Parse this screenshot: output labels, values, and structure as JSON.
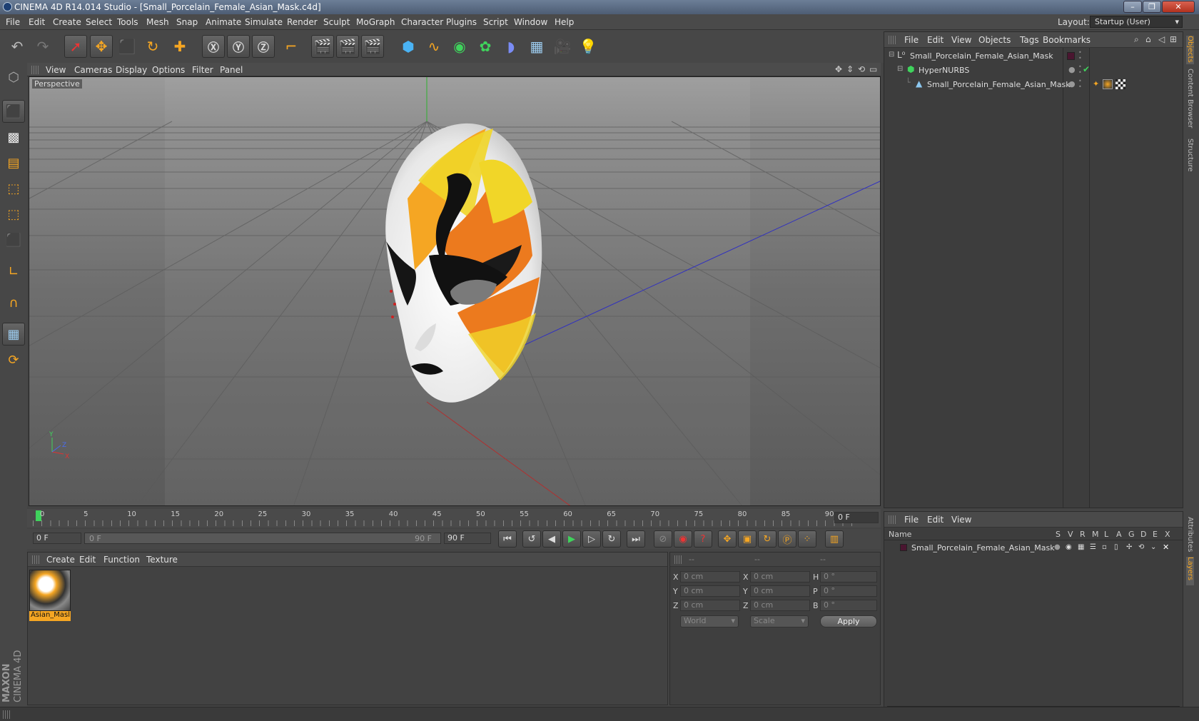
{
  "window": {
    "title": "CINEMA 4D R14.014 Studio - [Small_Porcelain_Female_Asian_Mask.c4d]"
  },
  "menu": [
    "File",
    "Edit",
    "Create",
    "Select",
    "Tools",
    "Mesh",
    "Snap",
    "Animate",
    "Simulate",
    "Render",
    "Sculpt",
    "MoGraph",
    "Character",
    "Plugins",
    "Script",
    "Window",
    "Help"
  ],
  "layout": {
    "label": "Layout:",
    "value": "Startup (User)"
  },
  "viewport": {
    "menu": [
      "View",
      "Cameras",
      "Display",
      "Options",
      "Filter",
      "Panel"
    ],
    "label": "Perspective",
    "axis": {
      "x": "X",
      "y": "Y",
      "z": "Z"
    }
  },
  "timeline": {
    "ticks": [
      "0",
      "5",
      "10",
      "15",
      "20",
      "25",
      "30",
      "35",
      "40",
      "45",
      "50",
      "55",
      "60",
      "65",
      "70",
      "75",
      "80",
      "85",
      "90"
    ],
    "current_frame": "0 F",
    "start_field": "0 F",
    "range_start": "0 F",
    "range_end": "90 F",
    "end_field": "90 F"
  },
  "material": {
    "menu": [
      "Create",
      "Edit",
      "Function",
      "Texture"
    ],
    "items": [
      {
        "name": "Asian_Masl"
      }
    ]
  },
  "coords": {
    "headers": [
      "--",
      "--",
      "--"
    ],
    "rows": [
      {
        "a": "X",
        "v1": "0 cm",
        "b": "X",
        "v2": "0 cm",
        "c": "H",
        "v3": "0 °"
      },
      {
        "a": "Y",
        "v1": "0 cm",
        "b": "Y",
        "v2": "0 cm",
        "c": "P",
        "v3": "0 °"
      },
      {
        "a": "Z",
        "v1": "0 cm",
        "b": "Z",
        "v2": "0 cm",
        "c": "B",
        "v3": "0 °"
      }
    ],
    "mode": "World",
    "transform": "Scale",
    "apply": "Apply"
  },
  "objects": {
    "menu": [
      "File",
      "Edit",
      "View",
      "Objects",
      "Tags",
      "Bookmarks"
    ],
    "tree": [
      {
        "name": "Small_Porcelain_Female_Asian_Mask",
        "indent": 0
      },
      {
        "name": "HyperNURBS",
        "indent": 1
      },
      {
        "name": "Small_Porcelain_Female_Asian_Mask",
        "indent": 2
      }
    ]
  },
  "layers": {
    "menu": [
      "File",
      "Edit",
      "View"
    ],
    "name_header": "Name",
    "cols": [
      "S",
      "V",
      "R",
      "M",
      "L",
      "A",
      "G",
      "D",
      "E",
      "X"
    ],
    "rows": [
      {
        "name": "Small_Porcelain_Female_Asian_Mask"
      }
    ]
  },
  "sidetabs": [
    "Objects",
    "Content Browser",
    "Structure",
    "Attributes",
    "Layers"
  ],
  "brand": {
    "line1": "MAXON",
    "line2": "CINEMA 4D"
  }
}
